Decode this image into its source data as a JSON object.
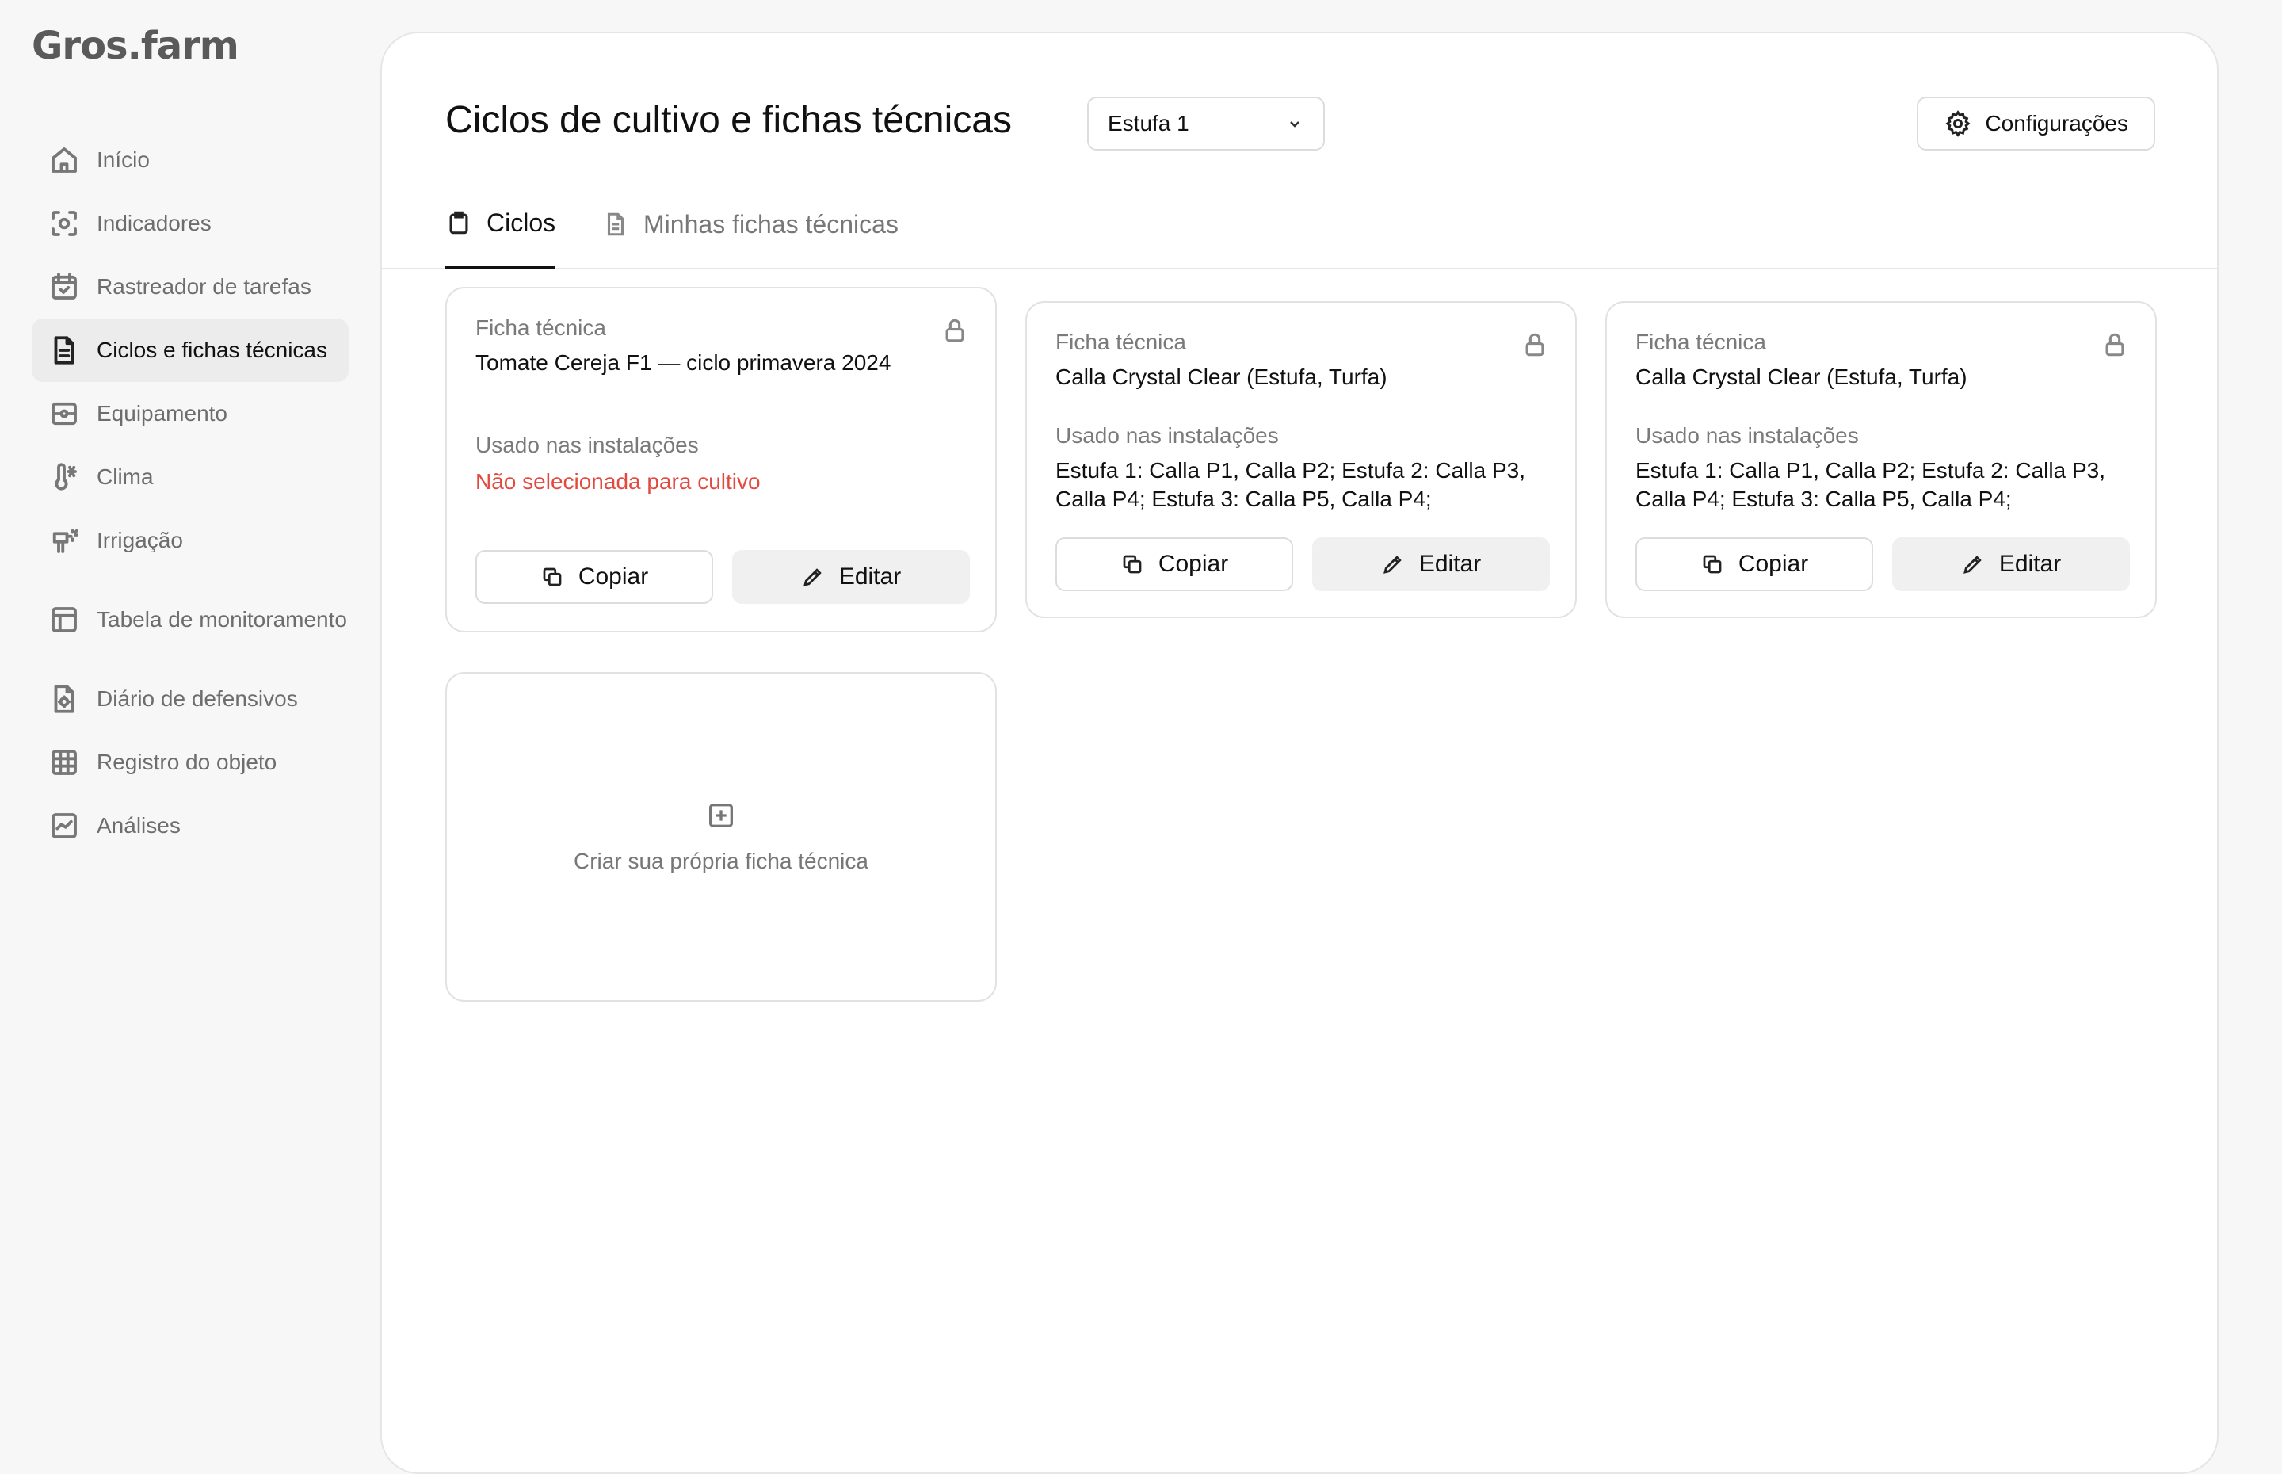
{
  "app": {
    "logo": "Gros.farm"
  },
  "sidebar": {
    "items": [
      {
        "label": "Início",
        "icon": "home-icon"
      },
      {
        "label": "Indicadores",
        "icon": "gauge-icon"
      },
      {
        "label": "Rastreador de tarefas",
        "icon": "calendar-check-icon"
      },
      {
        "label": "Ciclos e fichas técnicas",
        "icon": "document-icon",
        "active": true
      },
      {
        "label": "Equipamento",
        "icon": "equipment-icon"
      },
      {
        "label": "Clima",
        "icon": "thermometer-icon"
      },
      {
        "label": "Irrigação",
        "icon": "irrigation-icon"
      },
      {
        "label": "Tabela de monitoramento",
        "icon": "table-icon"
      },
      {
        "label": "Diário de defensivos",
        "icon": "gear-document-icon"
      },
      {
        "label": "Registro do objeto",
        "icon": "grid-icon"
      },
      {
        "label": "Análises",
        "icon": "chart-icon"
      }
    ]
  },
  "header": {
    "title": "Ciclos de cultivo e fichas técnicas",
    "greenhouse_select": "Estufa 1",
    "settings_label": "Configurações"
  },
  "tabs": [
    {
      "label": "Ciclos",
      "active": true
    },
    {
      "label": "Minhas fichas técnicas",
      "active": false
    }
  ],
  "cards": [
    {
      "label": "Ficha técnica",
      "name": "Tomate Cereja F1 — ciclo primavera 2024",
      "used_label": "Usado nas instalações",
      "used_value": "Não selecionada para cultivo",
      "copy_label": "Copiar",
      "edit_label": "Editar"
    },
    {
      "label": "Ficha técnica",
      "name": "Calla Crystal Clear (Estufa, Turfa)",
      "used_label": "Usado nas instalações",
      "used_value": "Estufa 1: Calla P1, Calla P2; Estufa 2: Calla P3, Calla P4; Estufa 3: Calla P5, Calla P4;",
      "copy_label": "Copiar",
      "edit_label": "Editar"
    },
    {
      "label": "Ficha técnica",
      "name": "Calla Crystal Clear (Estufa, Turfa)",
      "used_label": "Usado nas instalações",
      "used_value": "Estufa 1: Calla P1, Calla P2; Estufa 2: Calla P3, Calla P4; Estufa 3: Calla P5, Calla P4;",
      "copy_label": "Copiar",
      "edit_label": "Editar"
    }
  ],
  "create_card": {
    "label": "Criar sua própria ficha técnica"
  },
  "colors": {
    "warning": "#e24a3f",
    "active_nav_bg": "#ececec"
  }
}
